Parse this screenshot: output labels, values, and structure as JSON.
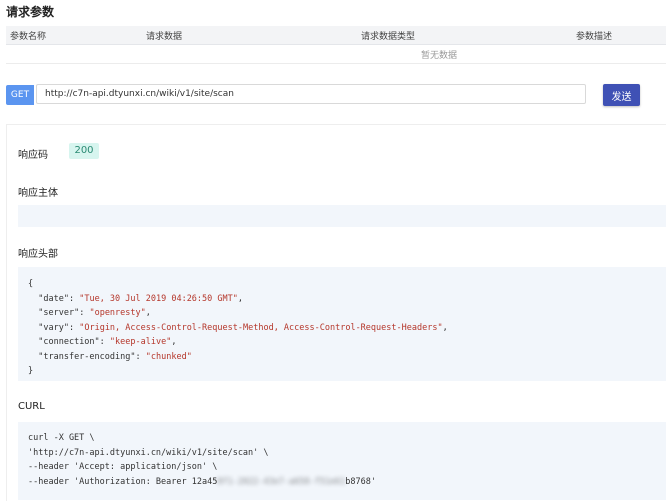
{
  "params": {
    "title": "请求参数",
    "columns": [
      "参数名称",
      "请求数据",
      "请求数据类型",
      "参数描述"
    ],
    "empty_text": "暂无数据"
  },
  "request": {
    "method": "GET",
    "url": "http://c7n-api.dtyunxi.cn/wiki/v1/site/scan",
    "send_label": "发送"
  },
  "response": {
    "code_label": "响应码",
    "code": "200",
    "body_label": "响应主体",
    "body": "",
    "headers_label": "响应头部",
    "headers": {
      "date": "Tue, 30 Jul 2019 04:26:50 GMT",
      "server": "openresty",
      "vary": "Origin, Access-Control-Request-Method, Access-Control-Request-Headers",
      "connection": "keep-alive",
      "transfer-encoding": "chunked"
    },
    "curl_label": "CURL",
    "curl_lines": [
      "curl -X GET \\",
      "'http://c7n-api.dtyunxi.cn/wiki/v1/site/scan' \\",
      "--header 'Accept: application/json' \\"
    ],
    "curl_auth_prefix": "--header 'Authorization: Bearer 12a45",
    "curl_auth_hidden": "8f1-2022-43e7-a658-f51e61",
    "curl_auth_suffix": "b8768'"
  },
  "colors": {
    "accent": "#3f51b5",
    "method_badge": "#5b95f0",
    "status_bg": "#d7f5ef",
    "string_value": "#b5372b",
    "code_bg": "#f2f6fb"
  }
}
